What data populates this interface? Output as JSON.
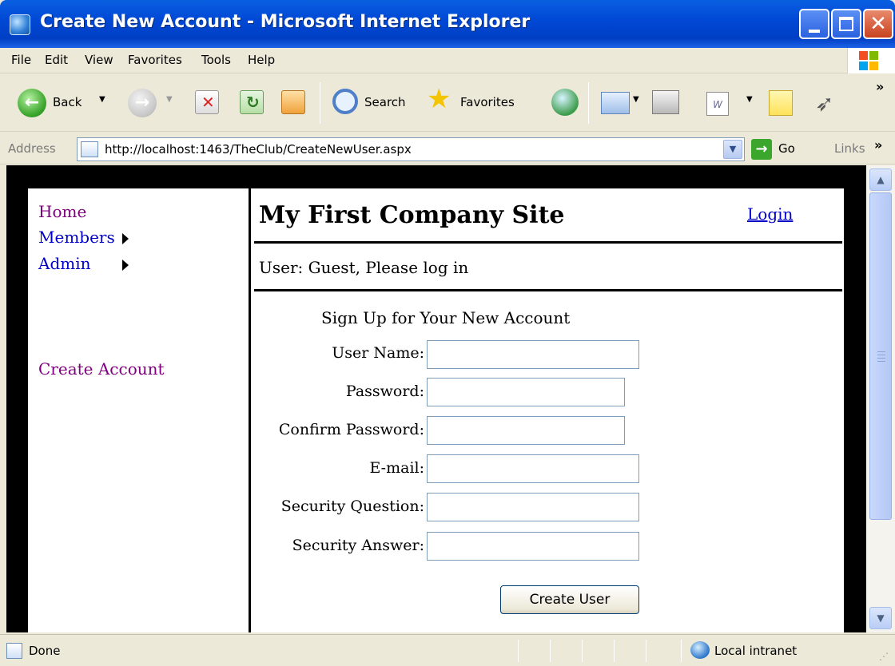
{
  "window": {
    "title": "Create New Account - Microsoft Internet Explorer"
  },
  "menu": {
    "items": [
      {
        "label": "File"
      },
      {
        "label": "Edit"
      },
      {
        "label": "View"
      },
      {
        "label": "Favorites"
      },
      {
        "label": "Tools"
      },
      {
        "label": "Help"
      }
    ]
  },
  "toolbar": {
    "back_label": "Back",
    "search_label": "Search",
    "favorites_label": "Favorites",
    "overflow": "»"
  },
  "address": {
    "label": "Address",
    "url": "http://localhost:1463/TheClub/CreateNewUser.aspx",
    "go_label": "Go",
    "links_label": "Links",
    "overflow": "»"
  },
  "page": {
    "sidebar": {
      "items": [
        {
          "label": "Home"
        },
        {
          "label": "Members"
        },
        {
          "label": "Admin"
        },
        {
          "label": "Create Account"
        }
      ]
    },
    "header": {
      "site_title": "My First Company Site",
      "login_link": "Login"
    },
    "user_status": "User: Guest, Please log in",
    "form": {
      "title": "Sign Up for Your New Account",
      "fields": [
        {
          "label": "User Name:",
          "value": ""
        },
        {
          "label": "Password:",
          "value": ""
        },
        {
          "label": "Confirm Password:",
          "value": ""
        },
        {
          "label": "E-mail:",
          "value": ""
        },
        {
          "label": "Security Question:",
          "value": ""
        },
        {
          "label": "Security Answer:",
          "value": ""
        }
      ],
      "submit_label": "Create User"
    }
  },
  "status": {
    "text": "Done",
    "zone": "Local intranet"
  },
  "icons": {
    "window": "ie-page-icon",
    "back": "back-arrow-icon",
    "forward": "forward-arrow-icon",
    "stop": "stop-icon",
    "refresh": "refresh-icon",
    "home": "home-icon",
    "search": "search-icon",
    "favorites": "favorites-star-icon",
    "media": "media-icon",
    "mail": "mail-icon",
    "print": "print-icon",
    "edit": "word-edit-icon",
    "discuss": "note-icon",
    "messenger": "messenger-icon"
  },
  "colors": {
    "titlebar": "#0054e3",
    "visited_link": "#800080",
    "link": "#0000cc",
    "page_background": "#000000"
  }
}
